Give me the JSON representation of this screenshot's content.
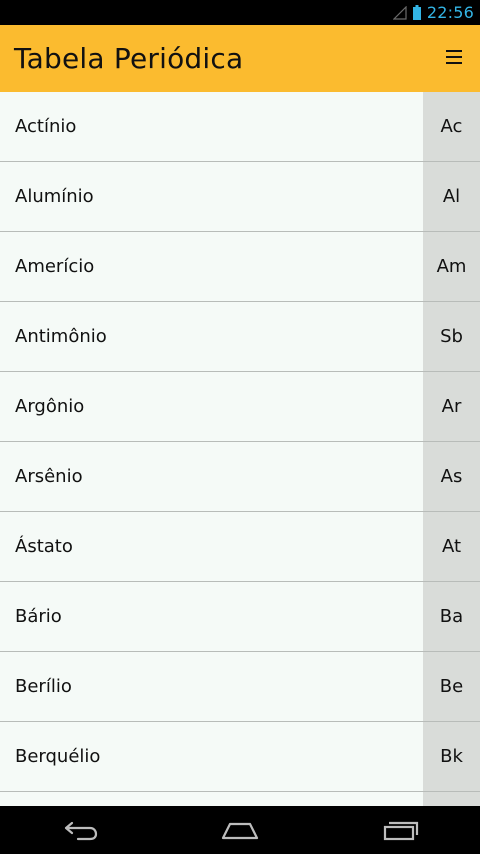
{
  "status_bar": {
    "time": "22:56"
  },
  "app_bar": {
    "title": "Tabela Periódica",
    "menu_icon": "menu-icon"
  },
  "elements": [
    {
      "name": "Actínio",
      "symbol": "Ac"
    },
    {
      "name": "Alumínio",
      "symbol": "Al"
    },
    {
      "name": "Amerício",
      "symbol": "Am"
    },
    {
      "name": "Antimônio",
      "symbol": "Sb"
    },
    {
      "name": "Argônio",
      "symbol": "Ar"
    },
    {
      "name": "Arsênio",
      "symbol": "As"
    },
    {
      "name": "Ástato",
      "symbol": "At"
    },
    {
      "name": "Bário",
      "symbol": "Ba"
    },
    {
      "name": "Berílio",
      "symbol": "Be"
    },
    {
      "name": "Berquélio",
      "symbol": "Bk"
    },
    {
      "name": "",
      "symbol": ""
    }
  ],
  "nav_bar": {
    "back_icon": "back-icon",
    "home_icon": "home-icon",
    "recents_icon": "recent-apps-icon"
  },
  "colors": {
    "app_bar": "#fbbb2f",
    "list_background": "#f5faf7",
    "symbol_column": "#d9dcd9",
    "status_time": "#33b5e5"
  }
}
